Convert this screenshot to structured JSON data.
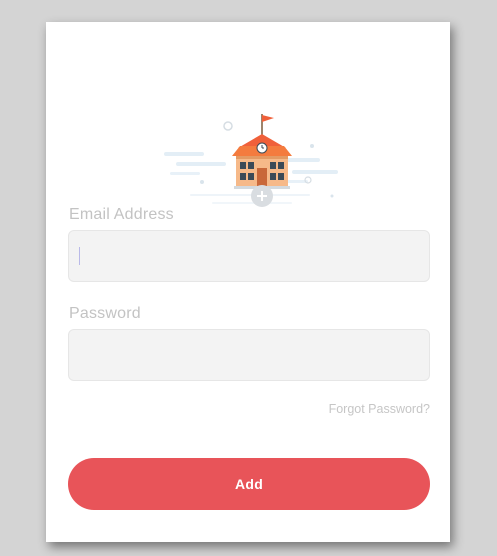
{
  "illustration": {
    "icon": "school-building-icon",
    "badge_icon": "plus-icon",
    "accent_color": "#f0603a"
  },
  "form": {
    "email_label": "Email Address",
    "email_value": "",
    "email_placeholder": "",
    "password_label": "Password",
    "password_value": "",
    "password_placeholder": "",
    "forgot_label": "Forgot Password?",
    "submit_label": "Add"
  },
  "colors": {
    "button": "#e85459",
    "field_bg": "#f3f3f3",
    "label": "#c3c3c3"
  }
}
